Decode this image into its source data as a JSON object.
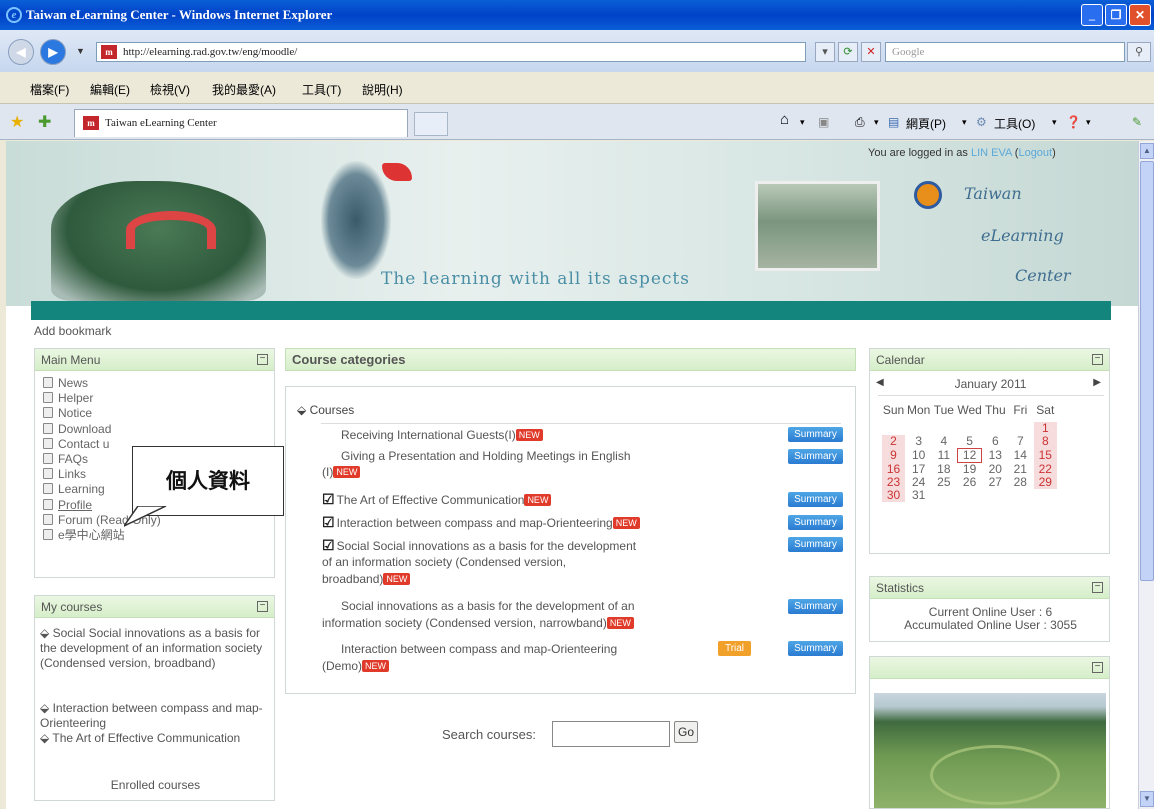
{
  "window": {
    "title": "Taiwan eLearning Center - Windows Internet Explorer"
  },
  "browser": {
    "url": "http://elearning.rad.gov.tw/eng/moodle/",
    "search_placeholder": "Google",
    "menu": [
      "檔案(F)",
      "編輯(E)",
      "檢視(V)",
      "我的最愛(A)",
      "工具(T)",
      "說明(H)"
    ],
    "tab_title": "Taiwan eLearning Center",
    "page_menu": "網頁(P)",
    "tools_menu": "工具(O)"
  },
  "header": {
    "logged_prefix": "You are logged in as ",
    "user": "LIN EVA",
    "logout_open": " (",
    "logout": "Logout",
    "logout_close": ")",
    "slogan": "The learning with all its aspects",
    "brand": [
      "Taiwan",
      "eLearning",
      "Center"
    ]
  },
  "add_bookmark": "Add bookmark",
  "main_menu": {
    "title": "Main Menu",
    "items": [
      "News",
      "Helper",
      "Notice",
      "Download",
      "Contact u",
      "FAQs",
      "Links",
      "Learning",
      "Profile",
      "Forum (Read Only)",
      "e學中心網站"
    ]
  },
  "callout": "個人資料",
  "my_courses": {
    "title": "My courses",
    "items": [
      "Social Social innovations as a basis for the development of an information society (Condensed version, broadband)",
      "Interaction between compass and map-Orienteering",
      "The Art of Effective Communication"
    ],
    "footer": "Enrolled courses"
  },
  "categories": {
    "title": "Course categories",
    "group": "Courses",
    "new": "NEW",
    "summary": "Summary",
    "trial": "Trial",
    "courses": [
      {
        "l1": "Receiving International Guests(I)"
      },
      {
        "l1": "Giving a Presentation and Holding Meetings in English",
        "l2": "(I)"
      },
      {
        "l1": "The Art of Effective Communication"
      },
      {
        "l1": "Interaction between compass and map-Orienteering"
      },
      {
        "l1": "Social Social innovations as a basis for the development",
        "l2": "of an information society (Condensed version,",
        "l3": "broadband)"
      },
      {
        "l1": "Social innovations as a basis for the development of an",
        "l2": "information society (Condensed version, narrowband)"
      },
      {
        "l1": "Interaction between compass and map-Orienteering",
        "l2": "(Demo)"
      }
    ]
  },
  "search": {
    "label": "Search courses:",
    "value": "",
    "go": "Go"
  },
  "calendar": {
    "title": "Calendar",
    "month": "January 2011",
    "days": [
      "Sun",
      "Mon",
      "Tue",
      "Wed",
      "Thu",
      "Fri",
      "Sat"
    ],
    "weeks": [
      [
        "",
        "",
        "",
        "",
        "",
        "",
        "1"
      ],
      [
        "2",
        "3",
        "4",
        "5",
        "6",
        "7",
        "8"
      ],
      [
        "9",
        "10",
        "11",
        "12",
        "13",
        "14",
        "15"
      ],
      [
        "16",
        "17",
        "18",
        "19",
        "20",
        "21",
        "22"
      ],
      [
        "23",
        "24",
        "25",
        "26",
        "27",
        "28",
        "29"
      ],
      [
        "30",
        "31",
        "",
        "",
        "",
        "",
        ""
      ]
    ],
    "today": "12"
  },
  "statistics": {
    "title": "Statistics",
    "online": "Current Online User : 6",
    "accumulated": "Accumulated Online User : 3055"
  },
  "colors": {
    "teal": "#14857c",
    "new_badge": "#e03a2a",
    "summary_badge": "#2a7bd1",
    "trial_badge": "#f1a02a",
    "callout_box": "#e02020"
  }
}
